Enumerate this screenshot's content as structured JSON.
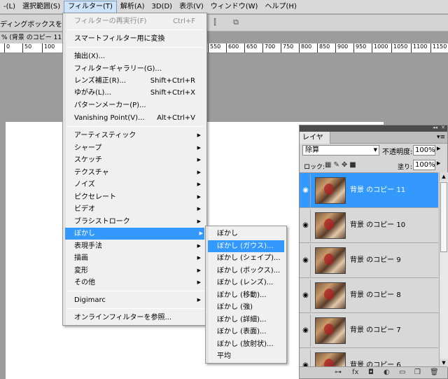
{
  "menubar": {
    "items": [
      "-(L)",
      "選択範囲(S)",
      "フィルター(T)",
      "解析(A)",
      "3D(D)",
      "表示(V)",
      "ウィンドウ(W)",
      "ヘルプ(H)"
    ],
    "active_index": 2
  },
  "optionsbar": {
    "text": "ディングボックスを表示"
  },
  "document": {
    "tab_title": "% (背景 のコピー 11,",
    "ruler_ticks": [
      "0",
      "50",
      "100",
      "550",
      "600",
      "650",
      "700",
      "750",
      "800",
      "850",
      "900",
      "950",
      "1000",
      "1050",
      "1100",
      "1150"
    ]
  },
  "filter_menu": {
    "items": [
      {
        "label": "フィルターの再実行(F)",
        "shortcut": "Ctrl+F",
        "disabled": true
      },
      {
        "label": "スマートフィルター用に変換"
      },
      {
        "label": "抽出(X)..."
      },
      {
        "label": "フィルターギャラリー(G)..."
      },
      {
        "label": "レンズ補正(R)...",
        "shortcut": "Shift+Ctrl+R"
      },
      {
        "label": "ゆがみ(L)...",
        "shortcut": "Shift+Ctrl+X"
      },
      {
        "label": "パターンメーカー(P)..."
      },
      {
        "label": "Vanishing Point(V)...",
        "shortcut": "Alt+Ctrl+V"
      },
      {
        "label": "アーティスティック"
      },
      {
        "label": "シャープ"
      },
      {
        "label": "スケッチ"
      },
      {
        "label": "テクスチャ"
      },
      {
        "label": "ノイズ"
      },
      {
        "label": "ピクセレート"
      },
      {
        "label": "ビデオ"
      },
      {
        "label": "ブラシストローク"
      },
      {
        "label": "ぼかし",
        "highlighted": true
      },
      {
        "label": "表現手法"
      },
      {
        "label": "描画"
      },
      {
        "label": "変形"
      },
      {
        "label": "その他"
      },
      {
        "label": "Digimarc"
      },
      {
        "label": "オンラインフィルターを参照..."
      }
    ]
  },
  "blur_submenu": {
    "items": [
      "ぼかし",
      "ぼかし (ガウス)...",
      "ぼかし (シェイプ)...",
      "ぼかし (ボックス)...",
      "ぼかし (レンズ)...",
      "ぼかし (移動)...",
      "ぼかし (強)",
      "ぼかし (詳細)...",
      "ぼかし (表面)...",
      "ぼかし (放射状)...",
      "平均"
    ],
    "highlighted_index": 1
  },
  "layers_panel": {
    "tab": "レイヤー",
    "blend_mode": "除算",
    "opacity_label": "不透明度:",
    "opacity": "100%",
    "lock_label": "ロック:",
    "fill_label": "塗り:",
    "fill": "100%",
    "layers": [
      {
        "name": "背景 のコピー 11",
        "selected": true
      },
      {
        "name": "背景 のコピー 10"
      },
      {
        "name": "背景 のコピー 9"
      },
      {
        "name": "背景 のコピー 8"
      },
      {
        "name": "背景 のコピー 7"
      },
      {
        "name": "背景 のコピー 6"
      }
    ]
  },
  "colors": {
    "highlight": "#3399ff",
    "menu_bg": "#f0f0f0"
  }
}
